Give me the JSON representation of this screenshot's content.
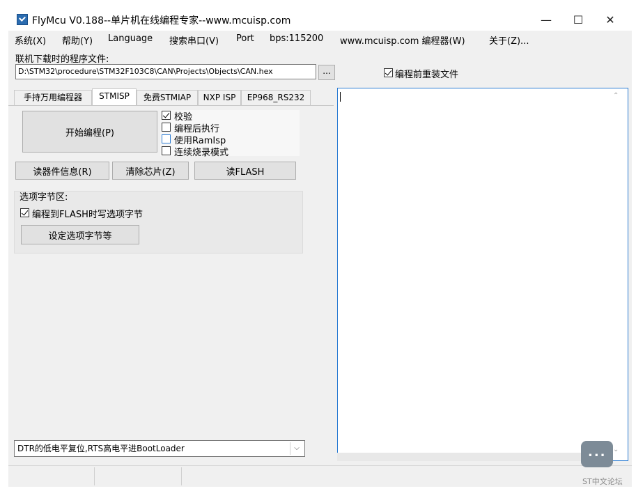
{
  "window": {
    "title": "FlyMcu V0.188--单片机在线编程专家--www.mcuisp.com",
    "minimize": "—",
    "maximize": "☐",
    "close": "✕"
  },
  "menu": {
    "items": [
      "系统(X)",
      "帮助(Y)",
      "Language",
      "搜索串口(V)",
      "Port",
      "bps:115200",
      "www.mcuisp.com 编程器(W)",
      "关于(Z)..."
    ]
  },
  "file": {
    "label": "联机下载时的程序文件:",
    "path": "D:\\STM32\\procedure\\STM32F103C8\\CAN\\Projects\\Objects\\CAN.hex",
    "browse": "...",
    "reload_label": "编程前重装文件",
    "reload_checked": true
  },
  "tabs": [
    "手持万用编程器",
    "STMISP",
    "免费STMIAP",
    "NXP ISP",
    "EP968_RS232"
  ],
  "active_tab": "STMISP",
  "stmisp": {
    "start_button": "开始编程(P)",
    "options": [
      {
        "label": "校验",
        "checked": true
      },
      {
        "label": "编程后执行",
        "checked": false
      },
      {
        "label": "使用RamIsp",
        "checked": false
      },
      {
        "label": "连续烧录模式",
        "checked": false
      }
    ],
    "read_info_button": "读器件信息(R)",
    "erase_button": "清除芯片(Z)",
    "read_flash_button": "读FLASH",
    "option_bytes": {
      "title": "选项字节区:",
      "write_label": "编程到FLASH时写选项字节",
      "write_checked": true,
      "set_button": "设定选项字节等"
    }
  },
  "reset_mode": {
    "value": "DTR的低电平复位,RTS高电平进BootLoader",
    "arrow": "⌵"
  },
  "log": {
    "text": "",
    "scroll_up": "⌃",
    "scroll_down": "⌄"
  },
  "watermark": {
    "text": "ST中文论坛"
  }
}
